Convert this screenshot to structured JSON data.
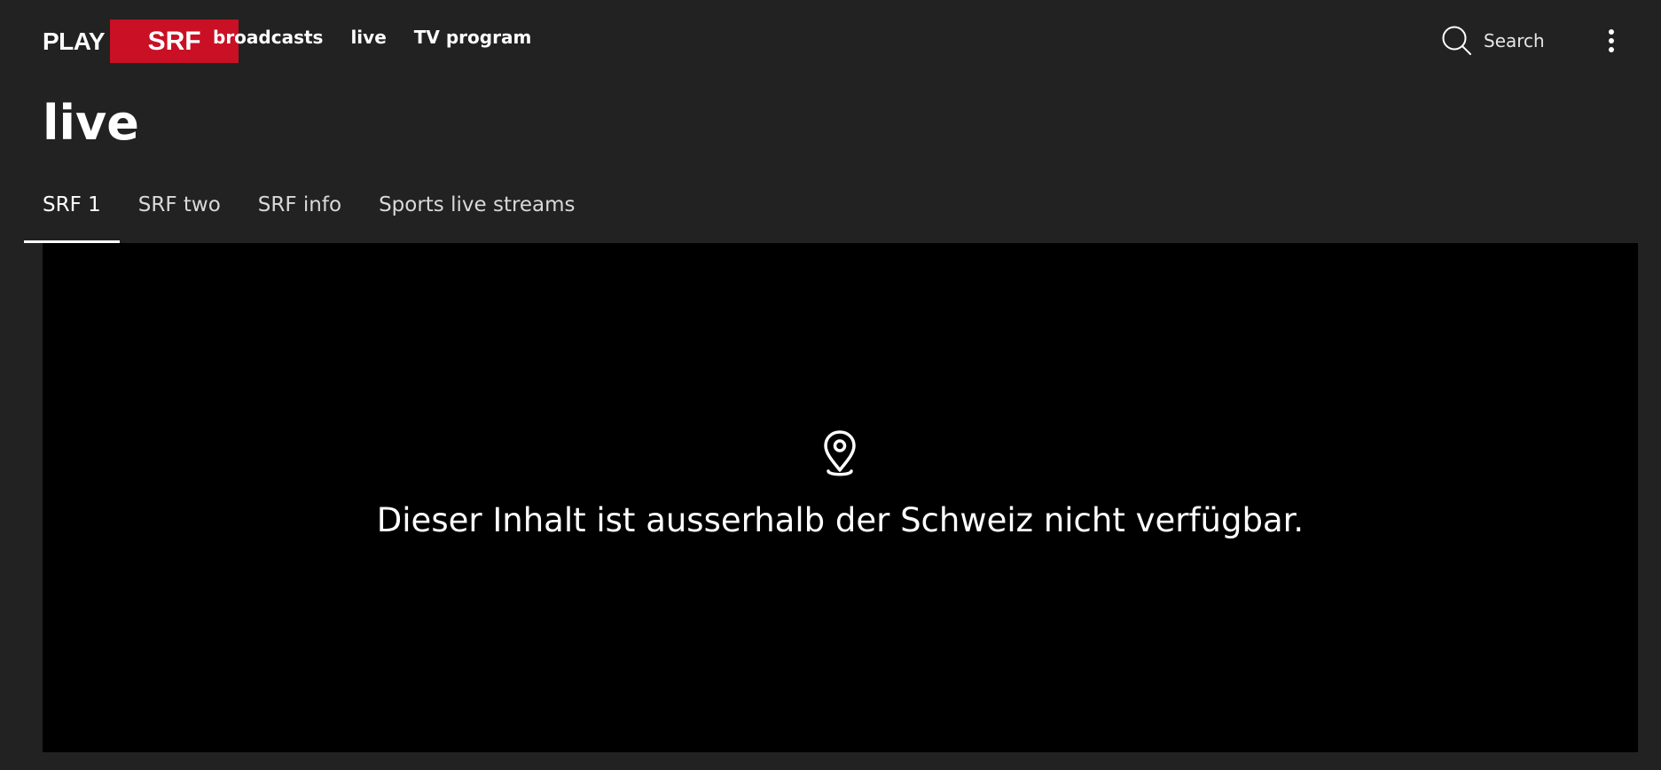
{
  "header": {
    "logo": {
      "play": "PLAY",
      "brand": "SRF",
      "brand_color": "#c91024"
    },
    "nav": [
      {
        "label": "broadcasts"
      },
      {
        "label": "live"
      },
      {
        "label": "TV program"
      }
    ],
    "search": {
      "label": "Search",
      "icon": "search-icon"
    },
    "menu": {
      "icon": "more-vertical-icon"
    }
  },
  "page": {
    "title": "live"
  },
  "tabs": [
    {
      "label": "SRF 1",
      "active": true
    },
    {
      "label": "SRF two",
      "active": false
    },
    {
      "label": "SRF info",
      "active": false
    },
    {
      "label": "Sports live streams",
      "active": false
    }
  ],
  "player": {
    "icon": "location-pin-icon",
    "message": "Dieser Inhalt ist ausserhalb der Schweiz nicht verfügbar."
  },
  "colors": {
    "background": "#222222",
    "player_background": "#000000",
    "text": "#ffffff"
  }
}
